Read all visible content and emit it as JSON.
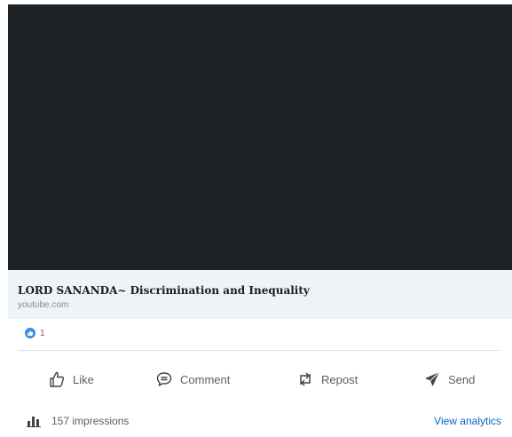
{
  "link": {
    "title": "LORD SANANDA~ Discrimination and Inequality",
    "source": "youtube.com"
  },
  "reactions": {
    "icon": "like-reaction-icon",
    "count": "1",
    "color": "#378fe9"
  },
  "actions": {
    "like": {
      "label": "Like",
      "icon": "thumbs-up-icon"
    },
    "comment": {
      "label": "Comment",
      "icon": "comment-bubble-icon"
    },
    "repost": {
      "label": "Repost",
      "icon": "repost-arrows-icon"
    },
    "send": {
      "label": "Send",
      "icon": "paper-plane-icon"
    }
  },
  "footer": {
    "impressions": "157 impressions",
    "impressions_icon": "bar-chart-icon",
    "analytics_label": "View analytics",
    "link_color": "#0a66c2"
  },
  "colors": {
    "video_background": "#1d2226",
    "card_background": "#eef3f8"
  }
}
